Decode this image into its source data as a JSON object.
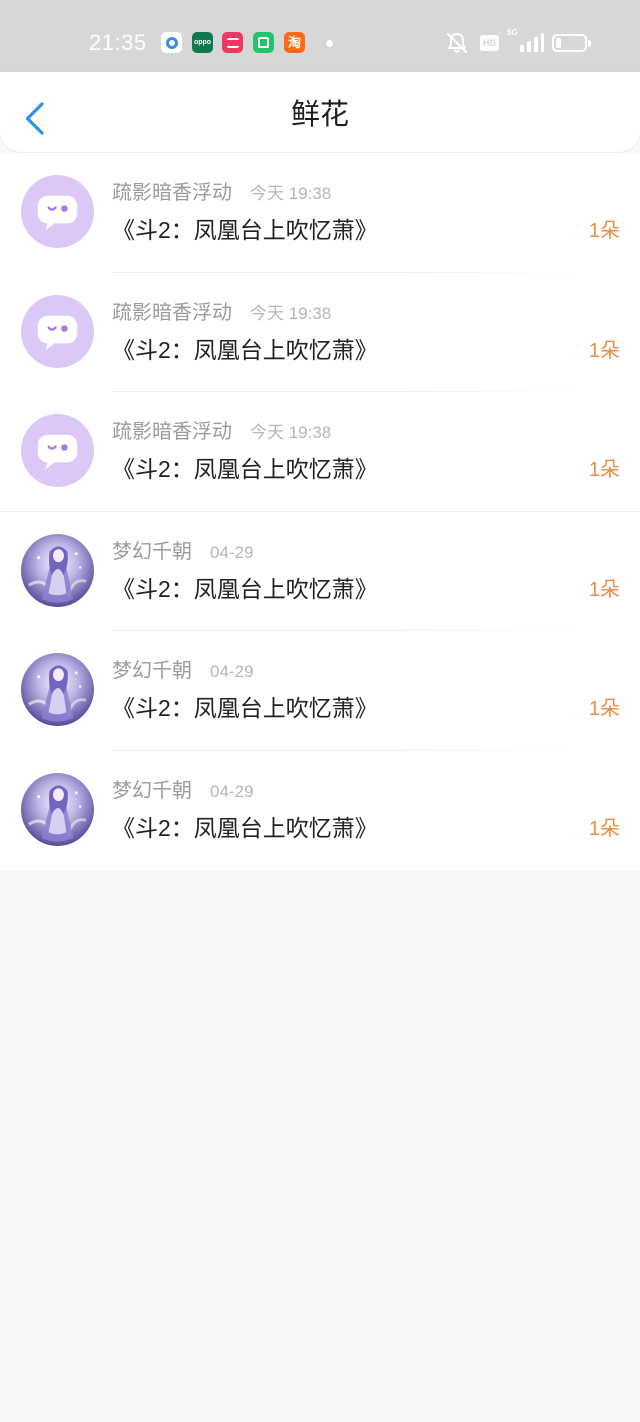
{
  "status_bar": {
    "time": "21:35",
    "notification_icons": [
      "blue-circle-app-icon",
      "oppo-app-icon",
      "pink-app-icon",
      "shopping-bag-app-icon",
      "taobao-app-icon"
    ],
    "oppo_icon_text": "oppo",
    "taobao_icon_text": "淘",
    "hd_badge": "HD",
    "network": "5G",
    "status_icons": [
      "mute-bell-icon",
      "hd-icon",
      "signal-icon",
      "battery-icon"
    ],
    "battery_level": 0.2
  },
  "header": {
    "title": "鲜花",
    "back_icon": "chevron-left-icon"
  },
  "colors": {
    "status_bar_bg": "#d7d7d7",
    "accent": "#2e90e8",
    "amount": "#f08a3d",
    "default_avatar_bg": "#dbc8f7",
    "page_bg": "#f9f7f8"
  },
  "records": [
    {
      "avatar": "chat-bubble-avatar",
      "user": "疏影暗香浮动",
      "time": "今天 19:38",
      "work": "《斗2：凤凰台上吹忆萧》",
      "amount": "1朵"
    },
    {
      "avatar": "chat-bubble-avatar",
      "user": "疏影暗香浮动",
      "time": "今天 19:38",
      "work": "《斗2：凤凰台上吹忆萧》",
      "amount": "1朵"
    },
    {
      "avatar": "chat-bubble-avatar",
      "user": "疏影暗香浮动",
      "time": "今天 19:38",
      "work": "《斗2：凤凰台上吹忆萧》",
      "amount": "1朵"
    },
    {
      "avatar": "anime-character-avatar",
      "user": "梦幻千朝",
      "time": "04-29",
      "work": "《斗2：凤凰台上吹忆萧》",
      "amount": "1朵"
    },
    {
      "avatar": "anime-character-avatar",
      "user": "梦幻千朝",
      "time": "04-29",
      "work": "《斗2：凤凰台上吹忆萧》",
      "amount": "1朵"
    },
    {
      "avatar": "anime-character-avatar",
      "user": "梦幻千朝",
      "time": "04-29",
      "work": "《斗2：凤凰台上吹忆萧》",
      "amount": "1朵"
    }
  ]
}
